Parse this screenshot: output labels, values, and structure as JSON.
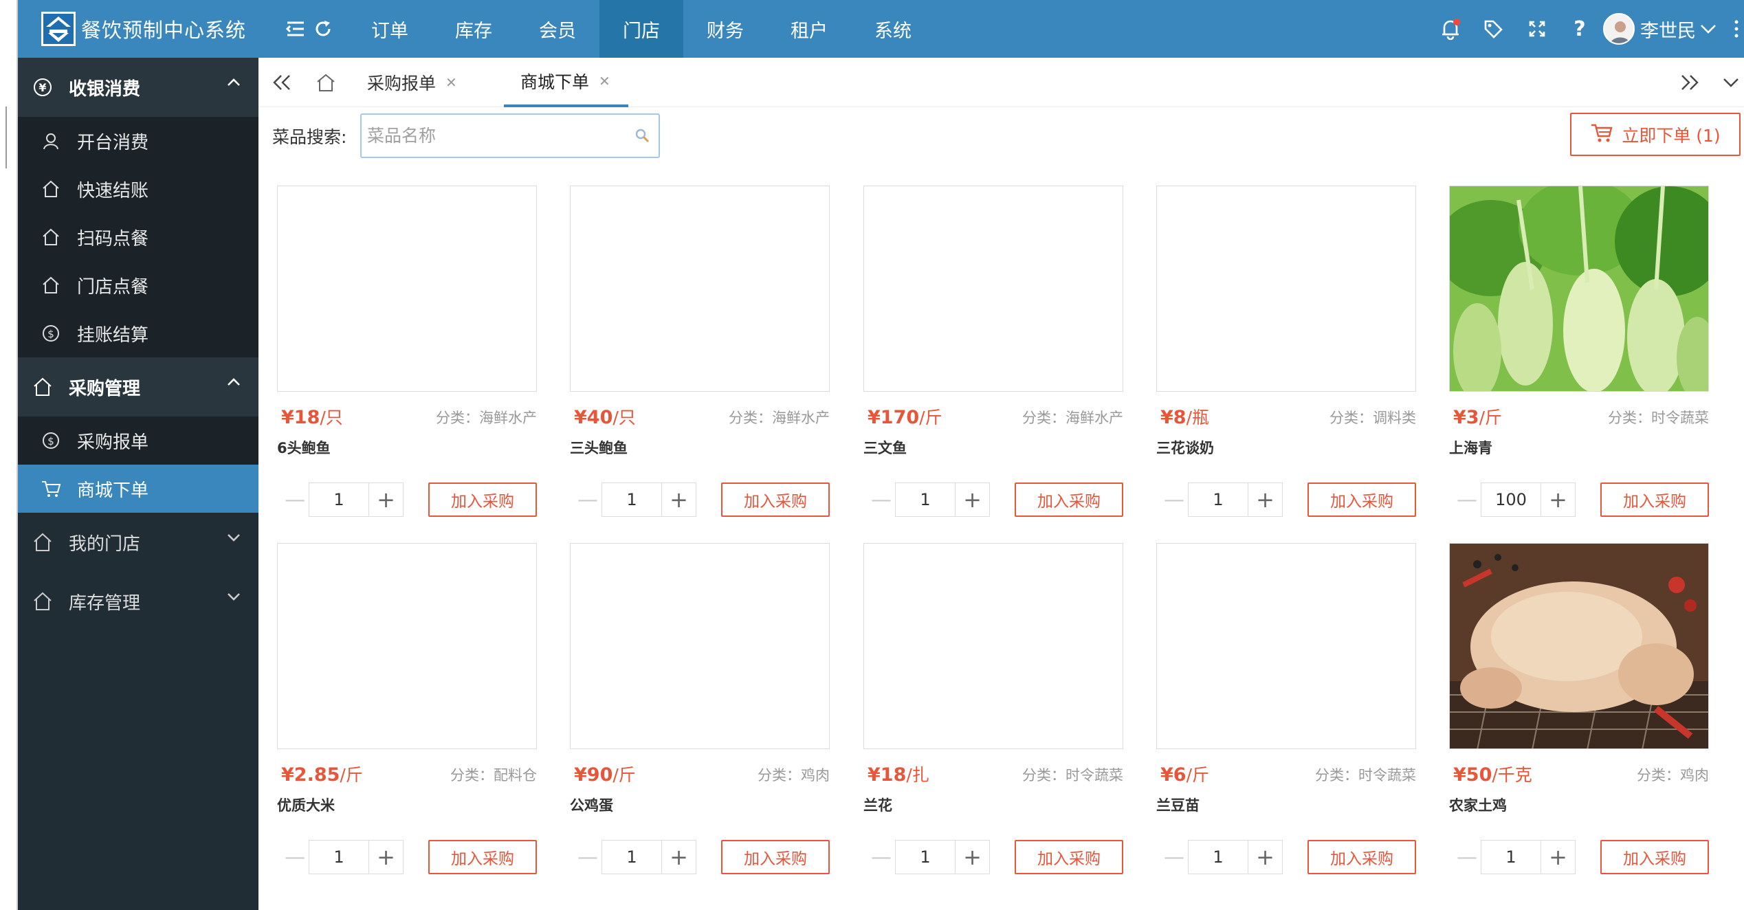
{
  "app": {
    "title": "餐饮预制中心系统"
  },
  "nav": {
    "items": [
      {
        "label": "订单"
      },
      {
        "label": "库存"
      },
      {
        "label": "会员"
      },
      {
        "label": "门店",
        "active": true
      },
      {
        "label": "财务"
      },
      {
        "label": "租户"
      },
      {
        "label": "系统"
      }
    ]
  },
  "user": {
    "name": "李世民"
  },
  "sidebar": {
    "groups": [
      {
        "label": "收银消费",
        "icon": "yen-circle-icon",
        "open": true,
        "items": [
          {
            "label": "开台消费",
            "icon": "user-icon"
          },
          {
            "label": "快速结账",
            "icon": "home-icon"
          },
          {
            "label": "扫码点餐",
            "icon": "home-icon"
          },
          {
            "label": "门店点餐",
            "icon": "home-icon"
          },
          {
            "label": "挂账结算",
            "icon": "dollar-circle-icon"
          }
        ]
      },
      {
        "label": "采购管理",
        "icon": "home-icon",
        "open": true,
        "items": [
          {
            "label": "采购报单",
            "icon": "dollar-circle-icon"
          },
          {
            "label": "商城下单",
            "icon": "cart-icon",
            "active": true
          }
        ]
      },
      {
        "label": "我的门店",
        "icon": "home-icon",
        "open": false,
        "items": []
      },
      {
        "label": "库存管理",
        "icon": "home-icon",
        "open": false,
        "items": []
      }
    ]
  },
  "tabs": [
    {
      "label": "采购报单",
      "active": false
    },
    {
      "label": "商城下单",
      "active": true
    }
  ],
  "search": {
    "label": "菜品搜索:",
    "placeholder": "菜品名称",
    "value": ""
  },
  "order_button": {
    "label": "立即下单 (1)"
  },
  "products": [
    {
      "price": "¥18",
      "unit": "/只",
      "category": "分类：海鲜水产",
      "name": "6头鲍鱼",
      "qty": "1",
      "image": "blank"
    },
    {
      "price": "¥40",
      "unit": "/只",
      "category": "分类：海鲜水产",
      "name": "三头鲍鱼",
      "qty": "1",
      "image": "blank"
    },
    {
      "price": "¥170",
      "unit": "/斤",
      "category": "分类：海鲜水产",
      "name": "三文鱼",
      "qty": "1",
      "image": "blank"
    },
    {
      "price": "¥8",
      "unit": "/瓶",
      "category": "分类：调料类",
      "name": "三花谈奶",
      "qty": "1",
      "image": "blank"
    },
    {
      "price": "¥3",
      "unit": "/斤",
      "category": "分类：时令蔬菜",
      "name": "上海青",
      "qty": "100",
      "image": "bok-choy"
    },
    {
      "price": "¥2.85",
      "unit": "/斤",
      "category": "分类：配料仓",
      "name": "优质大米",
      "qty": "1",
      "image": "blank"
    },
    {
      "price": "¥90",
      "unit": "/斤",
      "category": "分类：鸡肉",
      "name": "公鸡蛋",
      "qty": "1",
      "image": "blank"
    },
    {
      "price": "¥18",
      "unit": "/扎",
      "category": "分类：时令蔬菜",
      "name": "兰花",
      "qty": "1",
      "image": "blank"
    },
    {
      "price": "¥6",
      "unit": "/斤",
      "category": "分类：时令蔬菜",
      "name": "兰豆苗",
      "qty": "1",
      "image": "blank"
    },
    {
      "price": "¥50",
      "unit": "/千克",
      "category": "分类：鸡肉",
      "name": "农家土鸡",
      "qty": "1",
      "image": "chicken"
    }
  ],
  "add_button_label": "加入采购",
  "colors": {
    "header": "#3a87bd",
    "sidebar": "#212d34",
    "accent": "#e8563a"
  }
}
